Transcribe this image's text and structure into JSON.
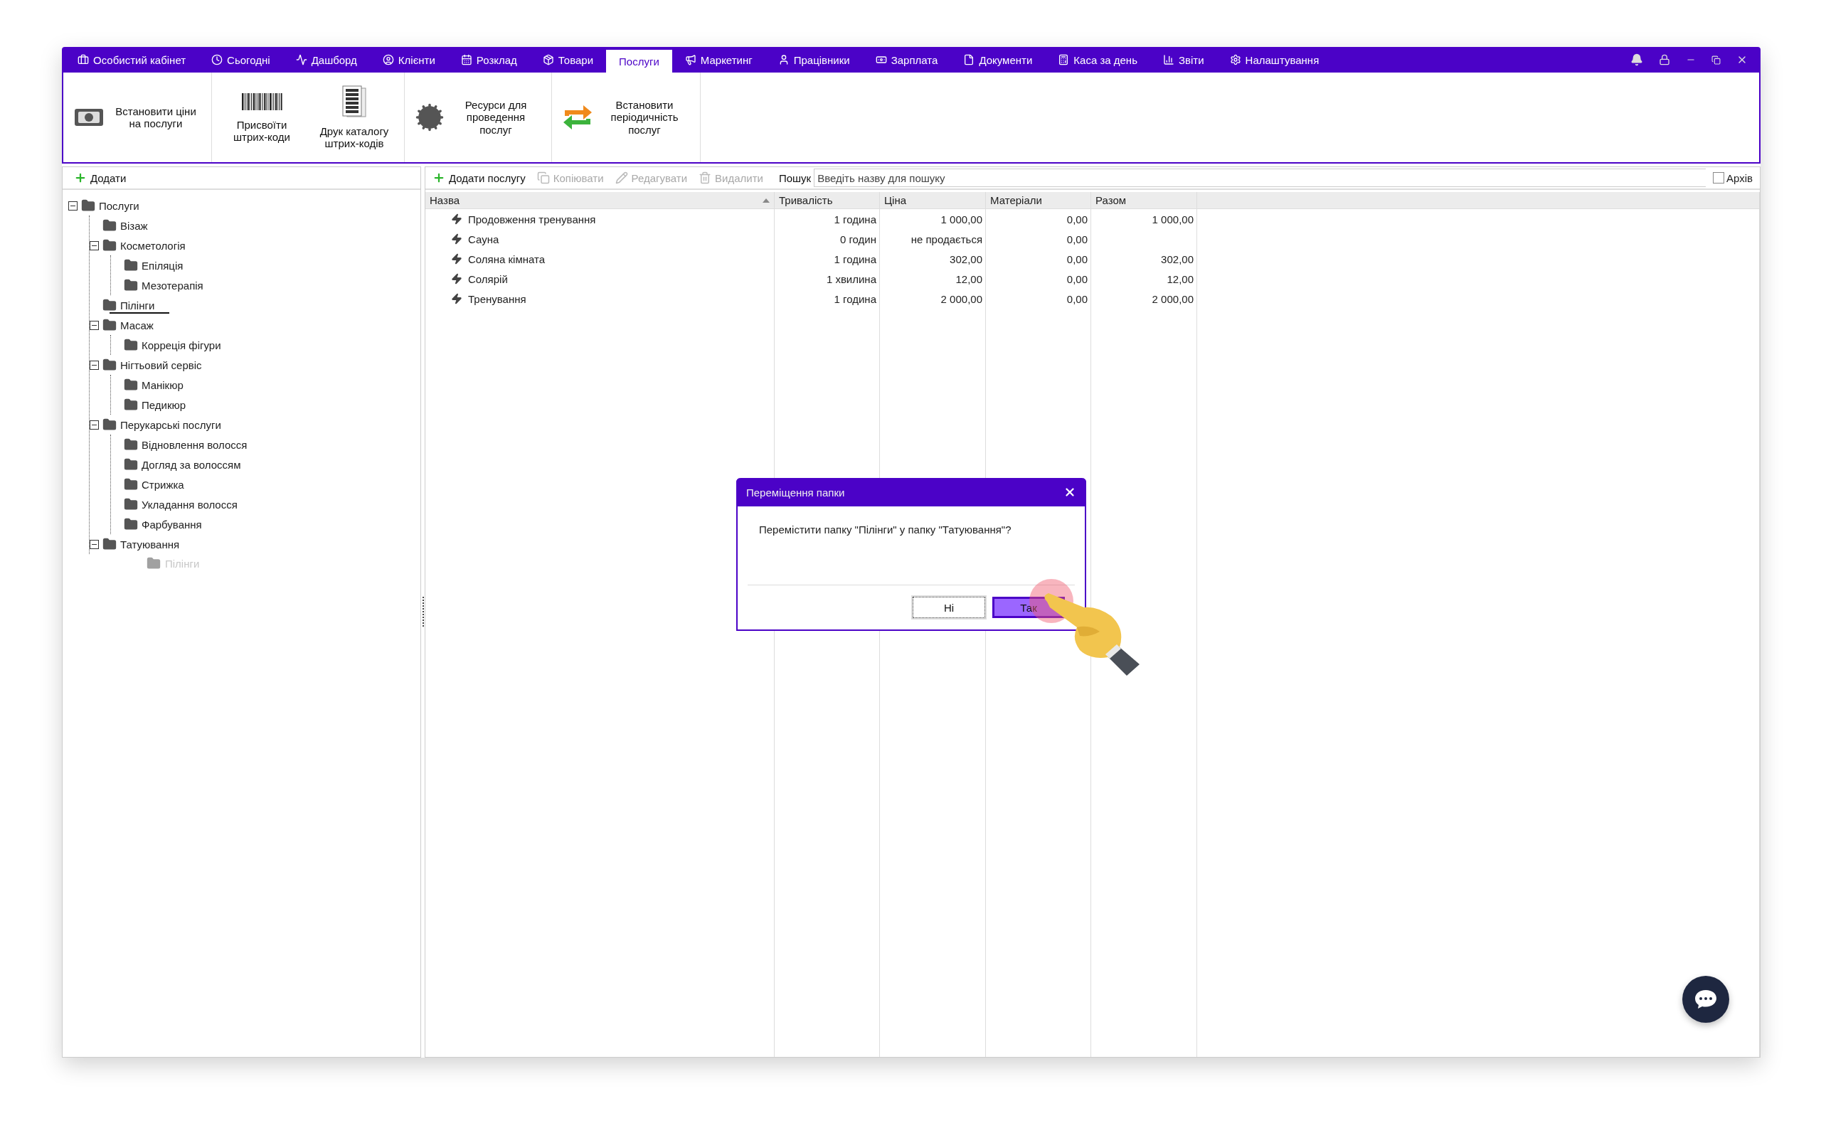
{
  "nav_tabs": [
    {
      "label": "Особистий кабінет",
      "selected": false
    },
    {
      "label": "Сьогодні",
      "selected": false
    },
    {
      "label": "Дашборд",
      "selected": false
    },
    {
      "label": "Клієнти",
      "selected": false
    },
    {
      "label": "Розклад",
      "selected": false
    },
    {
      "label": "Товари",
      "selected": false
    },
    {
      "label": "Послуги",
      "selected": true
    },
    {
      "label": "Маркетинг",
      "selected": false
    },
    {
      "label": "Працівники",
      "selected": false
    },
    {
      "label": "Зарплата",
      "selected": false
    },
    {
      "label": "Документи",
      "selected": false
    },
    {
      "label": "Каса за день",
      "selected": false
    },
    {
      "label": "Звіти",
      "selected": false
    },
    {
      "label": "Налаштування",
      "selected": false
    }
  ],
  "ribbon": {
    "groups": [
      {
        "buttons": [
          {
            "kind": "side",
            "label": "Встановити ціни на послуги"
          }
        ]
      },
      {
        "buttons": [
          {
            "kind": "top",
            "label": "Присвоїти штрих-коди"
          },
          {
            "kind": "top",
            "label": "Друк каталогу штрих-кодів"
          }
        ]
      },
      {
        "buttons": [
          {
            "kind": "side",
            "label": "Ресурси для проведення послуг"
          }
        ]
      },
      {
        "buttons": [
          {
            "kind": "side",
            "label": "Встановити періодичність послуг"
          }
        ]
      }
    ]
  },
  "tree_panel": {
    "add_button": "Додати",
    "tree": [
      {
        "label": "Послуги",
        "expanded": true,
        "drop_line": false,
        "children": [
          {
            "label": "Візаж",
            "drop_line": false
          },
          {
            "label": "Косметологія",
            "expanded": true,
            "drop_line": false,
            "children": [
              {
                "label": "Епіляція",
                "drop_line": false
              },
              {
                "label": "Мезотерапія",
                "drop_line": false
              }
            ]
          },
          {
            "label": "Пілінги",
            "drop_line": true
          },
          {
            "label": "Масаж",
            "expanded": true,
            "drop_line": false,
            "children": [
              {
                "label": "Корреція фігури",
                "drop_line": false
              }
            ]
          },
          {
            "label": "Нігтьовий сервіс",
            "expanded": true,
            "drop_line": false,
            "children": [
              {
                "label": "Манікюр",
                "drop_line": false
              },
              {
                "label": "Педикюр",
                "drop_line": false
              }
            ]
          },
          {
            "label": "Перукарські послуги",
            "expanded": true,
            "drop_line": false,
            "children": [
              {
                "label": "Відновлення волосся",
                "drop_line": false
              },
              {
                "label": "Догляд за волоссям",
                "drop_line": false
              },
              {
                "label": "Стрижка",
                "drop_line": false
              },
              {
                "label": "Укладання волосся",
                "drop_line": false
              },
              {
                "label": "Фарбування",
                "drop_line": false
              }
            ]
          },
          {
            "label": "Татуювання",
            "expanded": true,
            "drop_line": false
          }
        ]
      }
    ],
    "drag_ghost": {
      "label": "Пілінги"
    }
  },
  "toolbar": {
    "buttons": [
      {
        "label": "Додати послугу",
        "disabled": false
      },
      {
        "label": "Копіювати",
        "disabled": true
      },
      {
        "label": "Редагувати",
        "disabled": true
      },
      {
        "label": "Видалити",
        "disabled": true
      }
    ],
    "search_label": "Пошук",
    "search_placeholder": "Введіть назву для пошуку",
    "archive": {
      "label": "Архів",
      "checked": false
    }
  },
  "table": {
    "columns": [
      {
        "label": "Назва",
        "sorted": true
      },
      {
        "label": "Тривалість",
        "sorted": false
      },
      {
        "label": "Ціна",
        "sorted": false
      },
      {
        "label": "Матеріали",
        "sorted": false
      },
      {
        "label": "Разом",
        "sorted": false
      }
    ],
    "rows": [
      {
        "cells": [
          "Продовження тренування",
          "1 година",
          "1 000,00",
          "0,00",
          "1 000,00"
        ]
      },
      {
        "cells": [
          "Сауна",
          "0 годин",
          "не продається",
          "0,00"
        ]
      },
      {
        "cells": [
          "Соляна кімната",
          "1 година",
          "302,00",
          "0,00",
          "302,00"
        ]
      },
      {
        "cells": [
          "Солярій",
          "1 хвилина",
          "12,00",
          "0,00",
          "12,00"
        ]
      },
      {
        "cells": [
          "Тренування",
          "1 година",
          "2 000,00",
          "0,00",
          "2 000,00"
        ]
      }
    ]
  },
  "dialog": {
    "title": "Переміщення папки",
    "message": "Перемістити папку \"Пілінги\" у папку \"Татуювання\"?",
    "buttons": [
      {
        "label": "Ні",
        "kind": "secondary"
      },
      {
        "label": "Так",
        "kind": "primary"
      }
    ]
  }
}
